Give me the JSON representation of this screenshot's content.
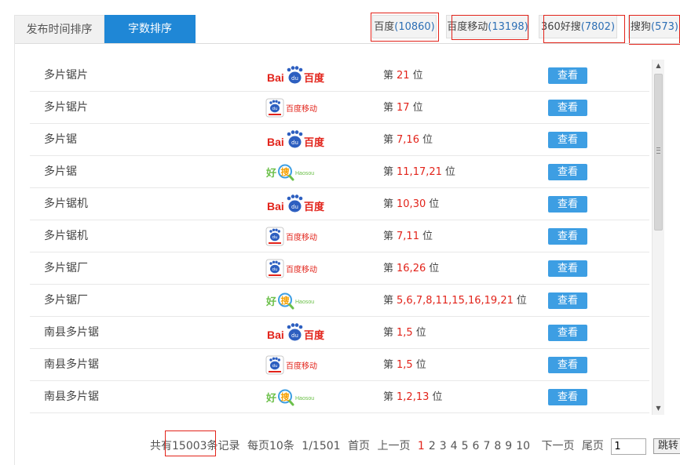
{
  "sort_tabs": [
    {
      "label": "发布时间排序",
      "active": false
    },
    {
      "label": "字数排序",
      "active": true
    }
  ],
  "engine_tabs": [
    {
      "name": "百度",
      "count": "(10860)"
    },
    {
      "name": "百度移动",
      "count": "(13198)"
    },
    {
      "name": "360好搜",
      "count": "(7802)"
    },
    {
      "name": "搜狗",
      "count": "(573)"
    }
  ],
  "logos": {
    "baidu": {
      "prefix": "Bai",
      "suffix": "百度",
      "paw_text": "du"
    },
    "baidu_mobile": {
      "text": "百度移动",
      "paw_text": "du"
    },
    "haosou": {
      "hao": "好",
      "sou": "搜",
      "latin": "Haosou"
    }
  },
  "rank_prefix": "第",
  "rank_suffix": "位",
  "view_label": "查看",
  "rows": [
    {
      "keyword": "多片锯片",
      "engine": "baidu",
      "positions": "21"
    },
    {
      "keyword": "多片锯片",
      "engine": "baidu_mobile",
      "positions": "17"
    },
    {
      "keyword": "多片锯",
      "engine": "baidu",
      "positions": "7,16"
    },
    {
      "keyword": "多片锯",
      "engine": "haosou",
      "positions": "11,17,21"
    },
    {
      "keyword": "多片锯机",
      "engine": "baidu",
      "positions": "10,30"
    },
    {
      "keyword": "多片锯机",
      "engine": "baidu_mobile",
      "positions": "7,11"
    },
    {
      "keyword": "多片锯厂",
      "engine": "baidu_mobile",
      "positions": "16,26"
    },
    {
      "keyword": "多片锯厂",
      "engine": "haosou",
      "positions": "5,6,7,8,11,15,16,19,21"
    },
    {
      "keyword": "南县多片锯",
      "engine": "baidu",
      "positions": "1,5"
    },
    {
      "keyword": "南县多片锯",
      "engine": "baidu_mobile",
      "positions": "1,5"
    },
    {
      "keyword": "南县多片锯",
      "engine": "haosou",
      "positions": "1,2,13"
    }
  ],
  "pager": {
    "total_prefix": "共有",
    "total": "15003",
    "total_suffix": "条记录",
    "per_page": "每页10条",
    "page_info": "1/1501",
    "first": "首页",
    "prev": "上一页",
    "pages": [
      "1",
      "2",
      "3",
      "4",
      "5",
      "6",
      "7",
      "8",
      "9",
      "10"
    ],
    "current": "1",
    "next": "下一页",
    "last": "尾页",
    "jump_value": "1",
    "jump_label": "跳转"
  },
  "colors": {
    "accent": "#1f87d6",
    "view_button": "#3d9ee3",
    "rank_number": "#e2231a",
    "highlight_box": "#e2231a",
    "count_link": "#2d6fb5"
  }
}
